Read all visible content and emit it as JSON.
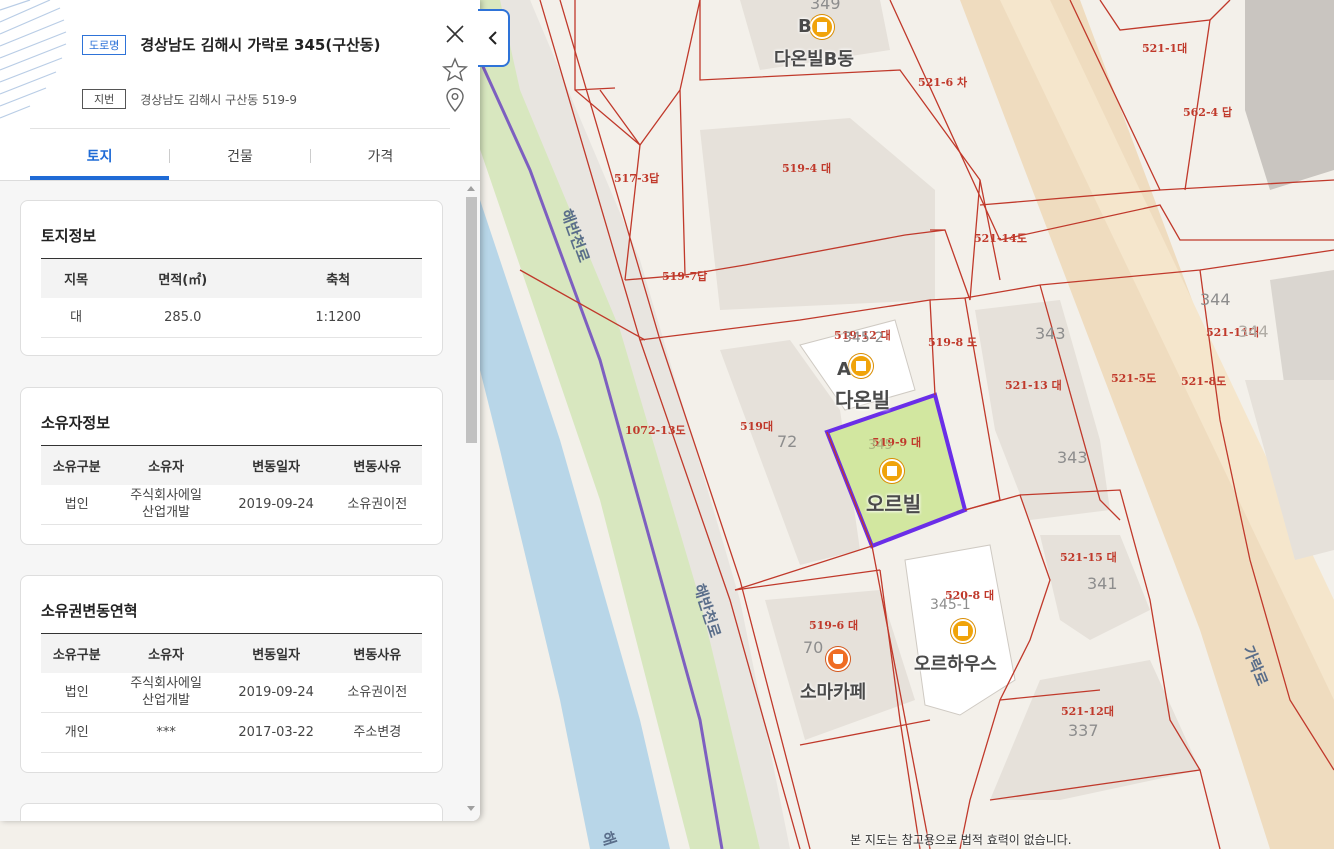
{
  "panel": {
    "road_tag": "도로명",
    "road_address": "경상남도 김해시 가락로 345(구산동)",
    "lot_tag": "지번",
    "lot_address": "경상남도 김해시 구산동 519-9",
    "tabs": [
      {
        "label": "토지",
        "active": true
      },
      {
        "label": "건물",
        "active": false
      },
      {
        "label": "가격",
        "active": false
      }
    ],
    "land_info": {
      "title": "토지정보",
      "headers": [
        "지목",
        "면적(㎡)",
        "축척"
      ],
      "rows": [
        [
          "대",
          "285.0",
          "1:1200"
        ]
      ]
    },
    "owner_info": {
      "title": "소유자정보",
      "headers": [
        "소유구분",
        "소유자",
        "변동일자",
        "변동사유"
      ],
      "rows": [
        [
          "법인",
          "주식회사에일\n산업개발",
          "2019-09-24",
          "소유권이전"
        ]
      ]
    },
    "ownership_history": {
      "title": "소유권변동연혁",
      "headers": [
        "소유구분",
        "소유자",
        "변동일자",
        "변동사유"
      ],
      "rows": [
        [
          "법인",
          "주식회사에일\n산업개발",
          "2019-09-24",
          "소유권이전"
        ],
        [
          "개인",
          "***",
          "2017-03-22",
          "주소변경"
        ]
      ]
    },
    "accent_color": "#1f6bd6"
  },
  "map": {
    "parcel_labels": [
      "521-1대",
      "521-6 차",
      "562-4 답",
      "519-4 대",
      "517-3답",
      "521-14도",
      "519-7답",
      "519-12 대",
      "519-8 도",
      "521-11대",
      "521-13 대",
      "521-5도",
      "521-8도",
      "1072-13도",
      "519대",
      "519-9 대",
      "521-15 대",
      "520-8 대",
      "519-6 대",
      "521-12대"
    ],
    "building_numbers": [
      "349",
      "344",
      "343",
      "345-2",
      "72",
      "343",
      "341",
      "345-1",
      "70",
      "337",
      "344",
      "345"
    ],
    "building_names": [
      "다온빌B동",
      "다온빌",
      "오르빌",
      "오르하우스",
      "소마카페"
    ],
    "building_letters": [
      "B",
      "A"
    ],
    "road_names": [
      "해반천로",
      "해반천로",
      "가락로",
      "해"
    ],
    "note": "본 지도는 참고용으로 법적 효력이 없습니다.",
    "selected_color": "#6a2ee8",
    "parcel_line_color": "#c0392b"
  }
}
